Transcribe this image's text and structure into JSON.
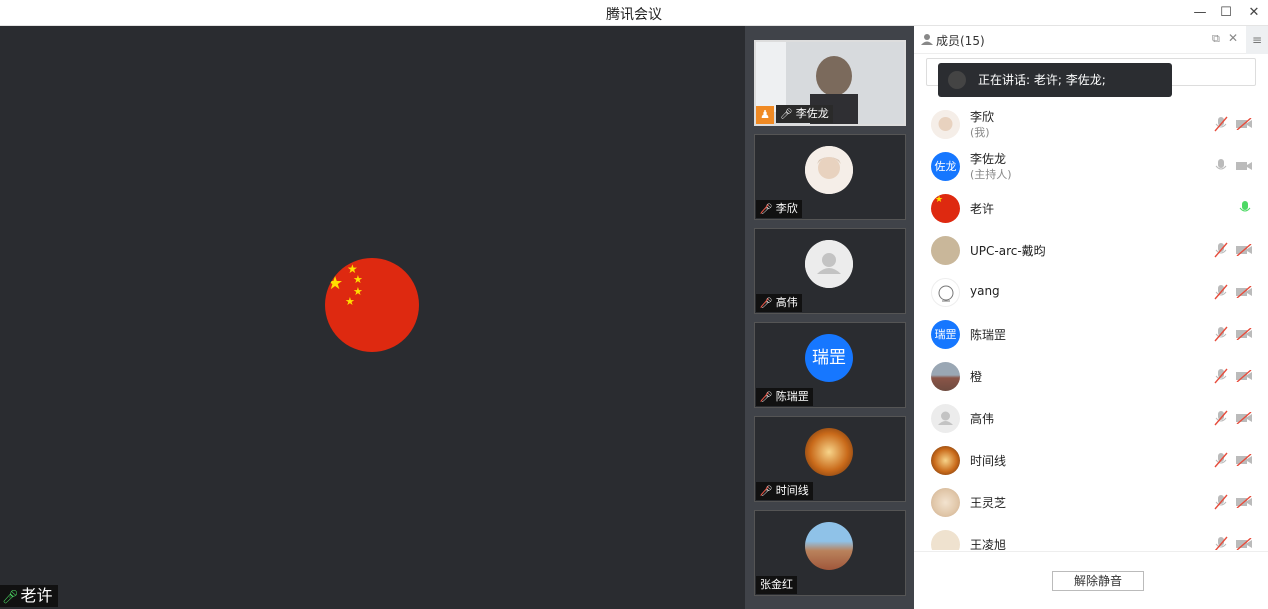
{
  "window": {
    "title": "腾讯会议"
  },
  "main_video": {
    "speaker_name": "老许"
  },
  "thumbnails": [
    {
      "name": "李佐龙"
    },
    {
      "name": "李欣"
    },
    {
      "name": "高伟"
    },
    {
      "name": "陈瑞罡",
      "avatar_text": "瑞罡"
    },
    {
      "name": "时间线"
    },
    {
      "name": "张金红"
    }
  ],
  "panel": {
    "title": "成员(15)",
    "toast": "正在讲话: 老许; 李佐龙;",
    "members": [
      {
        "name": "李欣",
        "sub": "(我)"
      },
      {
        "name": "李佐龙",
        "sub": "(主持人)",
        "avatar_text": "佐龙"
      },
      {
        "name": "老许"
      },
      {
        "name": "UPC-arc-戴昀"
      },
      {
        "name": "yang"
      },
      {
        "name": "陈瑞罡",
        "avatar_text": "瑞罡"
      },
      {
        "name": "橙"
      },
      {
        "name": "高伟"
      },
      {
        "name": "时间线"
      },
      {
        "name": "王灵芝"
      },
      {
        "name": "王凌旭"
      }
    ],
    "unmute_label": "解除静音"
  },
  "colors": {
    "accent_blue": "#1677ff",
    "flag_red": "#de2910",
    "mic_on_green": "#4cd964"
  }
}
